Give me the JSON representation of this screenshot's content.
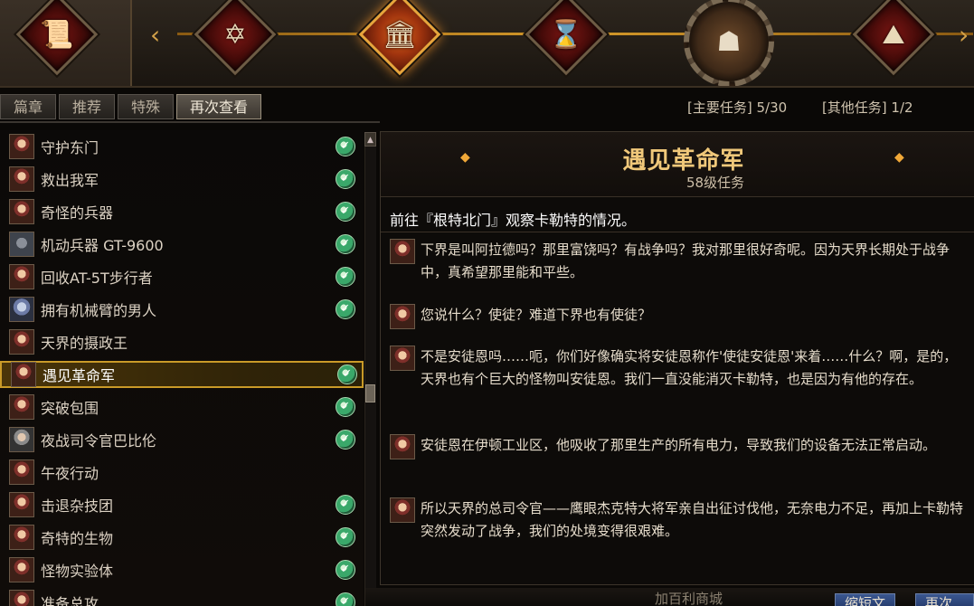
{
  "banner": {
    "chapters": [
      {
        "icon": "scroll-icon",
        "glyph": "📜"
      },
      {
        "icon": "star-of-david-icon",
        "glyph": "✡"
      },
      {
        "icon": "castle-icon",
        "glyph": "🏛",
        "active": true
      },
      {
        "icon": "hourglass-icon",
        "glyph": "⌛"
      },
      {
        "icon": "mech-face-icon",
        "glyph": "☗",
        "current": true
      },
      {
        "icon": "volcano-icon",
        "glyph": "⛰"
      }
    ],
    "prev_arrow": "‹",
    "next_arrow": "›"
  },
  "tabs": [
    {
      "label": "篇章",
      "active": false
    },
    {
      "label": "推荐",
      "active": false
    },
    {
      "label": "特殊",
      "active": false
    },
    {
      "label": "再次查看",
      "active": true
    }
  ],
  "counts": {
    "main": "[主要任务] 5/30",
    "other": "[其他任务] 1/2"
  },
  "quests": [
    {
      "name": "守护东门",
      "portrait": "default",
      "done": true
    },
    {
      "name": "救出我军",
      "portrait": "default",
      "done": true
    },
    {
      "name": "奇怪的兵器",
      "portrait": "default",
      "done": true
    },
    {
      "name": "机动兵器 GT-9600",
      "portrait": "mech",
      "done": true
    },
    {
      "name": "回收AT-5T步行者",
      "portrait": "default",
      "done": true
    },
    {
      "name": "拥有机械臂的男人",
      "portrait": "blue",
      "done": true
    },
    {
      "name": "天界的摄政王",
      "portrait": "default",
      "done": false
    },
    {
      "name": "遇见革命军",
      "portrait": "default",
      "done": true,
      "selected": true
    },
    {
      "name": "突破包围",
      "portrait": "default",
      "done": true
    },
    {
      "name": "夜战司令官巴比伦",
      "portrait": "grey",
      "done": true
    },
    {
      "name": "午夜行动",
      "portrait": "default",
      "done": false
    },
    {
      "name": "击退杂技团",
      "portrait": "default",
      "done": true
    },
    {
      "name": "奇特的生物",
      "portrait": "default",
      "done": true
    },
    {
      "name": "怪物实验体",
      "portrait": "default",
      "done": true
    },
    {
      "name": "准备总攻",
      "portrait": "default",
      "done": true
    }
  ],
  "detail": {
    "title": "遇见革命军",
    "level": "58级任务",
    "objective": "前往『根特北门』观察卡勒特的情况。",
    "dialogues": [
      "下界是叫阿拉德吗？那里富饶吗？有战争吗？我对那里很好奇呢。因为天界长期处于战争中，真希望那里能和平些。",
      "您说什么？使徒？难道下界也有使徒？",
      "不是安徒恩吗……呃，你们好像确实将安徒恩称作'使徒安徒恩'来着……什么？啊，是的，天界也有个巨大的怪物叫安徒恩。我们一直没能消灭卡勒特，也是因为有他的存在。",
      "安徒恩在伊顿工业区，他吸收了那里生产的所有电力，导致我们的设备无法正常启动。",
      "所以天界的总司令官——鹰眼杰克特大将军亲自出征讨伐他，无奈电力不足，再加上卡勒特突然发动了战争，我们的处境变得很艰难。"
    ]
  },
  "footer": {
    "label": "加百利商城",
    "btn1": "缩短文",
    "btn2": "再次挑战"
  }
}
